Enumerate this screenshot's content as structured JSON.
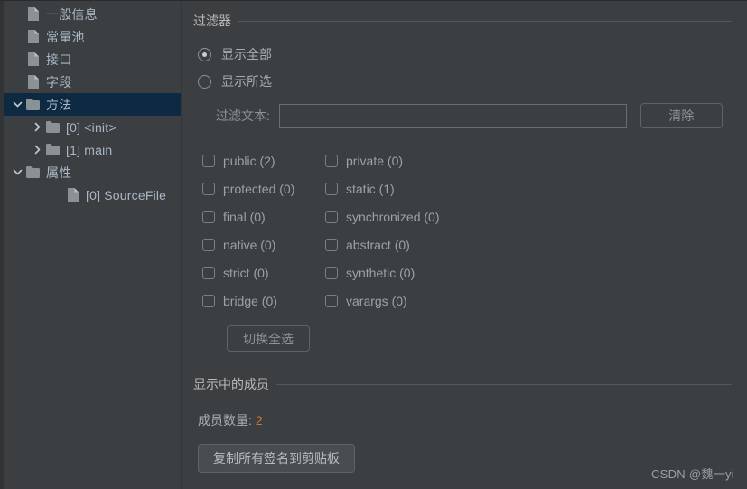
{
  "tree": {
    "items": [
      {
        "label": "一般信息",
        "icon": "file-icon",
        "arrow": "none",
        "depth": 1,
        "selected": false
      },
      {
        "label": "常量池",
        "icon": "file-icon",
        "arrow": "none",
        "depth": 1,
        "selected": false
      },
      {
        "label": "接口",
        "icon": "file-icon",
        "arrow": "none",
        "depth": 1,
        "selected": false
      },
      {
        "label": "字段",
        "icon": "file-icon",
        "arrow": "none",
        "depth": 1,
        "selected": false
      },
      {
        "label": "方法",
        "icon": "folder-icon",
        "arrow": "chevron-down-icon",
        "depth": 0,
        "selected": true
      },
      {
        "label": "[0] <init>",
        "icon": "folder-icon",
        "arrow": "chevron-right-icon",
        "depth": 2,
        "selected": false
      },
      {
        "label": "[1] main",
        "icon": "folder-icon",
        "arrow": "chevron-right-icon",
        "depth": 2,
        "selected": false
      },
      {
        "label": "属性",
        "icon": "folder-icon",
        "arrow": "chevron-down-icon",
        "depth": 0,
        "selected": false
      },
      {
        "label": "[0] SourceFile",
        "icon": "file-icon",
        "arrow": "none",
        "depth": 3,
        "selected": false
      }
    ]
  },
  "filter": {
    "group_title": "过滤器",
    "radios": [
      {
        "label": "显示全部",
        "checked": true
      },
      {
        "label": "显示所选",
        "checked": false
      }
    ],
    "filter_text_label": "过滤文本:",
    "filter_text_value": "",
    "filter_text_placeholder": "",
    "clear_button": "清除",
    "modifiers": [
      {
        "label": "public (2)",
        "checked": false
      },
      {
        "label": "private (0)",
        "checked": false
      },
      {
        "label": "protected (0)",
        "checked": false
      },
      {
        "label": "static (1)",
        "checked": false
      },
      {
        "label": "final (0)",
        "checked": false
      },
      {
        "label": "synchronized (0)",
        "checked": false
      },
      {
        "label": "native (0)",
        "checked": false
      },
      {
        "label": "abstract (0)",
        "checked": false
      },
      {
        "label": "strict (0)",
        "checked": false
      },
      {
        "label": "synthetic (0)",
        "checked": false
      },
      {
        "label": "bridge (0)",
        "checked": false
      },
      {
        "label": "varargs (0)",
        "checked": false
      }
    ],
    "toggle_all_button": "切换全选"
  },
  "members": {
    "group_title": "显示中的成员",
    "count_label": "成员数量:",
    "count_value": "2",
    "count_color": "#cc7832",
    "copy_button": "复制所有签名到剪贴板"
  },
  "watermark": "CSDN @魏一yi"
}
